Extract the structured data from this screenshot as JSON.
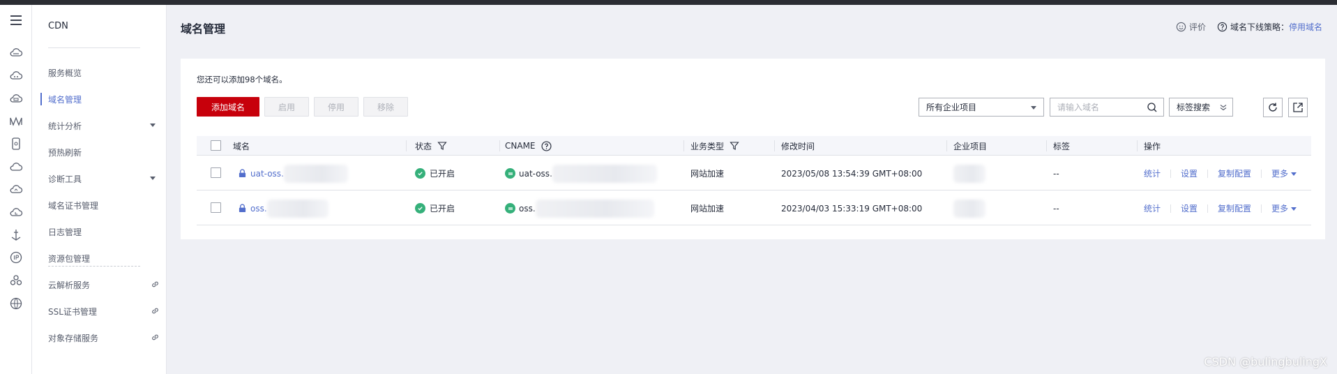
{
  "rail_icons": [
    "menu-icon",
    "cloud-icon",
    "cloud-upload-icon",
    "cloud-storage-icon",
    "bridge-icon",
    "phone-icon",
    "cloud-outline-icon",
    "cloud-sync-icon",
    "cloud-refresh-icon",
    "anchor-icon",
    "ip-icon",
    "cluster-icon",
    "globe-icon"
  ],
  "nav": {
    "title": "CDN",
    "items": [
      {
        "label": "服务概览"
      },
      {
        "label": "域名管理"
      },
      {
        "label": "统计分析"
      },
      {
        "label": "预热刷新"
      },
      {
        "label": "诊断工具"
      },
      {
        "label": "域名证书管理"
      },
      {
        "label": "日志管理"
      },
      {
        "label": "资源包管理"
      },
      {
        "label": "云解析服务"
      },
      {
        "label": "SSL证书管理"
      },
      {
        "label": "对象存储服务"
      }
    ]
  },
  "header": {
    "title": "域名管理",
    "feedback": "评价",
    "offline_policy": "域名下线策略：",
    "disable_domain": "停用域名"
  },
  "toolbar": {
    "note": "您还可以添加98个域名。",
    "add": "添加域名",
    "enable": "启用",
    "disable": "停用",
    "remove": "移除",
    "project_select": "所有企业项目",
    "search_placeholder": "请输入域名",
    "tag_search": "标签搜索"
  },
  "table": {
    "headers": {
      "domain": "域名",
      "status": "状态",
      "cname": "CNAME",
      "service": "业务类型",
      "modified": "修改时间",
      "project": "企业项目",
      "tags": "标签",
      "ops": "操作"
    },
    "rows": [
      {
        "domain": "uat-oss.",
        "status": "已开启",
        "cname": "uat-oss.",
        "service": "网站加速",
        "modified": "2023/05/08 13:54:39 GMT+08:00",
        "tags": "--"
      },
      {
        "domain": "oss.",
        "status": "已开启",
        "cname": "oss.",
        "service": "网站加速",
        "modified": "2023/04/03 15:33:19 GMT+08:00",
        "tags": "--"
      }
    ],
    "ops": {
      "stats": "统计",
      "settings": "设置",
      "copy": "复制配置",
      "more": "更多"
    }
  },
  "watermark": "CSDN @bulingbulingX",
  "colors": {
    "brand_red": "#c7000b",
    "link_blue": "#526ecc",
    "ok_green": "#35b07a"
  }
}
